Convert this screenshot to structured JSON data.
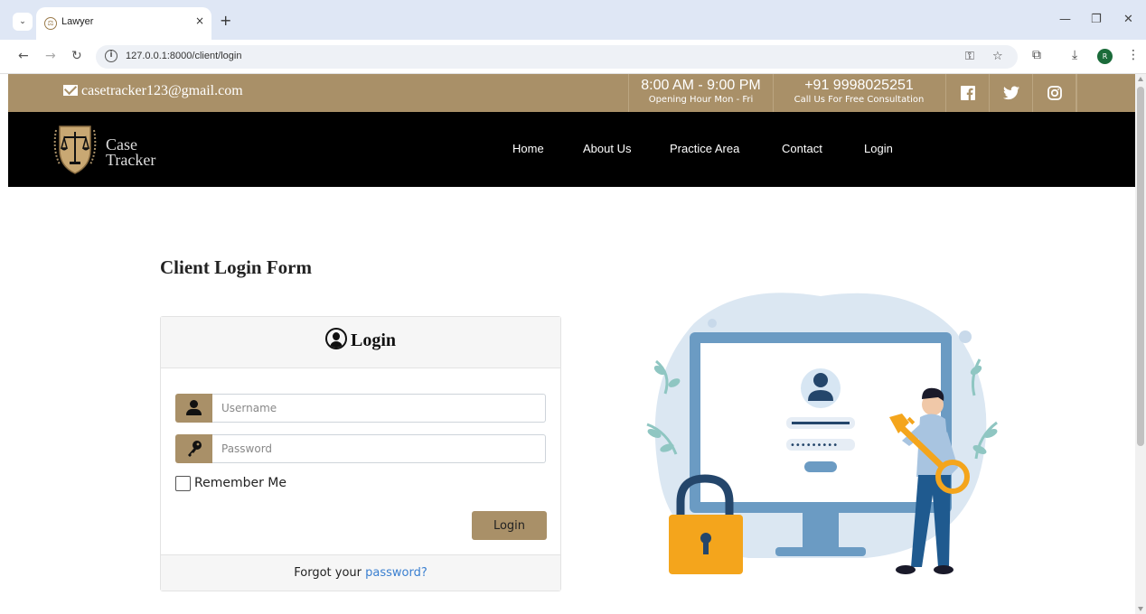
{
  "browser": {
    "tab_title": "Lawyer",
    "tab_close": "×",
    "new_tab": "+",
    "url": "127.0.0.1:8000/client/login",
    "avatar_letter": "R"
  },
  "topbar": {
    "email": "casetracker123@gmail.com",
    "hours": "8:00 AM - 9:00 PM",
    "hours_sub": "Opening Hour Mon - Fri",
    "phone": "+91 9998025251",
    "phone_sub": "Call Us For Free Consultation",
    "social": [
      "facebook-icon",
      "twitter-icon",
      "instagram-icon"
    ]
  },
  "brand": {
    "line1": "Case",
    "line2": "Tracker"
  },
  "nav": {
    "items": [
      "Home",
      "About Us",
      "Practice Area",
      "Contact",
      "Login"
    ]
  },
  "form": {
    "page_title": "Client Login Form",
    "card_title": "Login",
    "username_placeholder": "Username",
    "password_placeholder": "Password",
    "remember_label": "Remember Me",
    "submit_label": "Login",
    "forgot_prefix": "Forgot your ",
    "forgot_link": "password?"
  },
  "colors": {
    "accent": "#a99068",
    "nav_bg": "#000000",
    "link": "#3a7fd0"
  }
}
